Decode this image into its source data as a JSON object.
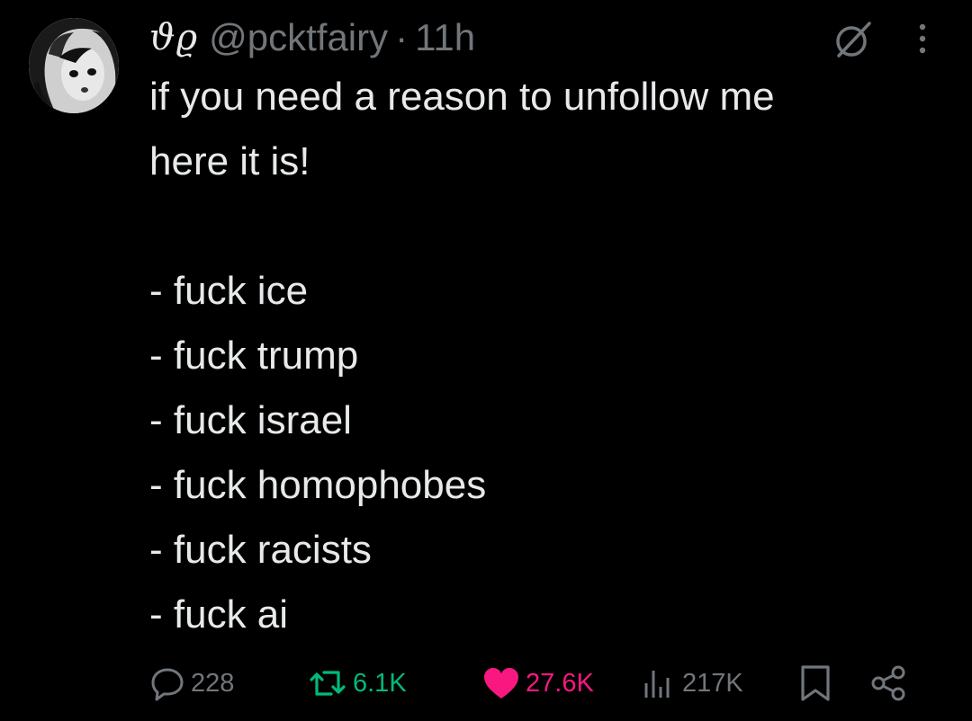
{
  "post": {
    "display_name": "ϑϱ",
    "handle": "@pcktfairy",
    "separator": "·",
    "time": "11h",
    "lines": [
      "if you need a reason to unfollow me",
      "here it is!",
      "",
      "- fuck ice",
      "- fuck trump",
      "- fuck israel",
      "- fuck homophobes",
      "- fuck racists",
      "- fuck ai"
    ]
  },
  "actions": {
    "replies": "228",
    "reposts": "6.1K",
    "likes": "27.6K",
    "views": "217K"
  },
  "icons": {
    "header": [
      "grok-icon",
      "more-icon"
    ],
    "actions": [
      "reply-icon",
      "repost-icon",
      "like-icon",
      "views-icon",
      "bookmark-icon",
      "share-icon"
    ]
  },
  "colors": {
    "background": "#000000",
    "text": "#e7e9ea",
    "muted": "#71767b",
    "repost": "#00ba7c",
    "like": "#f91880"
  }
}
